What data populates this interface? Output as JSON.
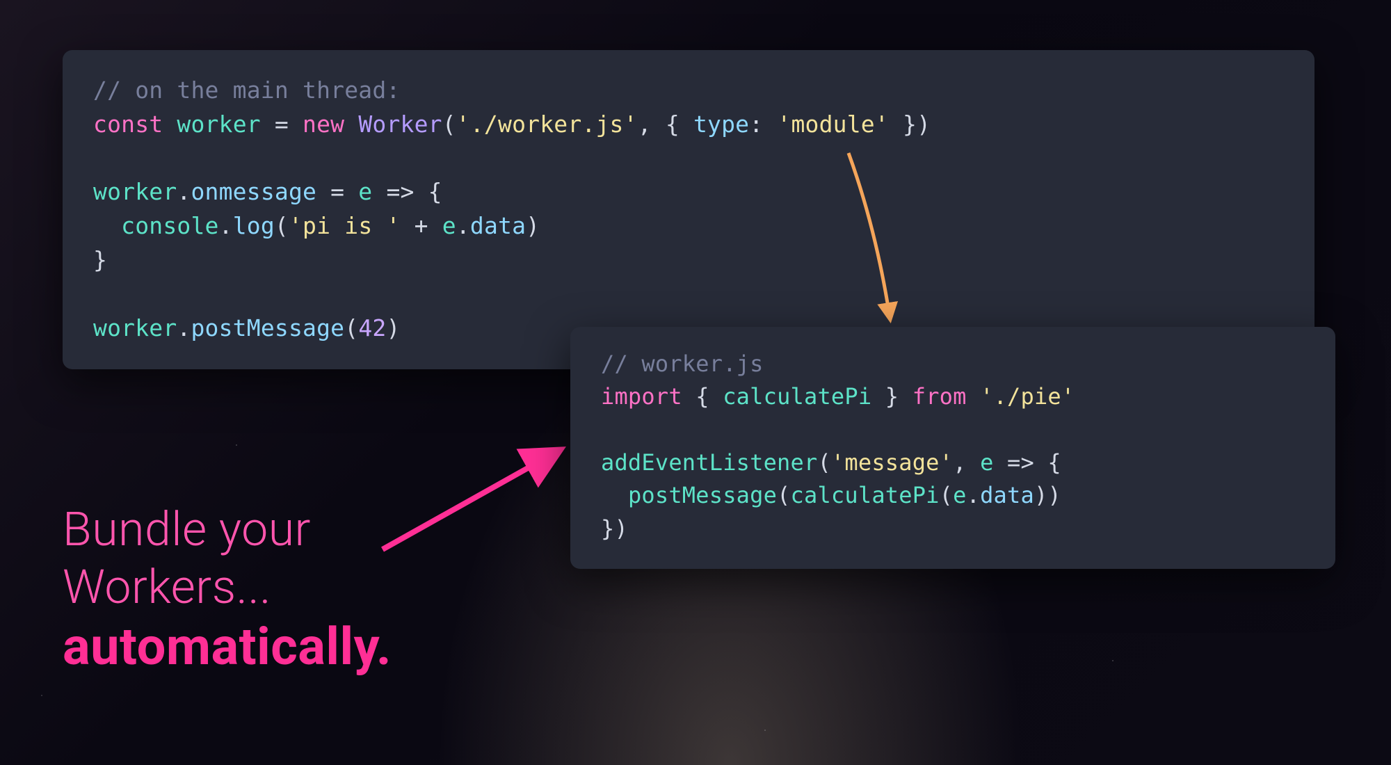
{
  "main_code": {
    "comment": "// on the main thread:",
    "l1_const": "const",
    "l1_worker": "worker",
    "l1_eq": " = ",
    "l1_new": "new",
    "l1_Worker": "Worker",
    "l1_open": "(",
    "l1_path": "'./worker.js'",
    "l1_comma": ", { ",
    "l1_type": "type",
    "l1_colon": ": ",
    "l1_module": "'module'",
    "l1_close": " })",
    "l3_worker": "worker",
    "l3_dot": ".",
    "l3_onmessage": "onmessage",
    "l3_arrow": " = ",
    "l3_e": "e",
    "l3_fat": " => {",
    "l4_pad": "  ",
    "l4_console": "console",
    "l4_dot": ".",
    "l4_log": "log",
    "l4_open": "(",
    "l4_str": "'pi is '",
    "l4_plus": " + ",
    "l4_e": "e",
    "l4_dot2": ".",
    "l4_data": "data",
    "l4_close": ")",
    "l5_brace": "}",
    "l7_worker": "worker",
    "l7_dot": ".",
    "l7_post": "postMessage",
    "l7_open": "(",
    "l7_num": "42",
    "l7_close": ")"
  },
  "worker_code": {
    "comment": "// worker.js",
    "l1_import": "import",
    "l1_brace_o": " { ",
    "l1_calc": "calculatePi",
    "l1_brace_c": " } ",
    "l1_from": "from",
    "l1_sp": " ",
    "l1_path": "'./pie'",
    "l3_add": "addEventListener",
    "l3_open": "(",
    "l3_msg": "'message'",
    "l3_comma": ", ",
    "l3_e": "e",
    "l3_fat": " => {",
    "l4_pad": "  ",
    "l4_post": "postMessage",
    "l4_open": "(",
    "l4_calc": "calculatePi",
    "l4_open2": "(",
    "l4_e": "e",
    "l4_dot": ".",
    "l4_data": "data",
    "l4_close": "))",
    "l5_brace": "})"
  },
  "caption": {
    "line1": "Bundle your",
    "line2": "Workers...",
    "line3": "automatically."
  },
  "colors": {
    "panel": "#272b38",
    "pink": "#ff3fa0",
    "orange": "#f5a55a"
  }
}
